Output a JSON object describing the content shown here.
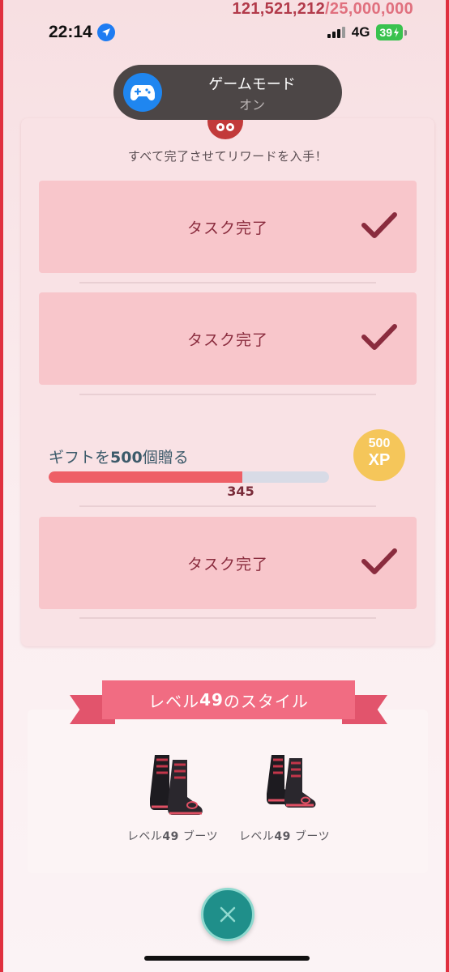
{
  "top_progress": {
    "current": "121,521,212",
    "separator": "/",
    "goal": "25,000,000"
  },
  "status_bar": {
    "time": "22:14",
    "network": "4G",
    "battery": "39"
  },
  "toast": {
    "title": "ゲームモード",
    "subtitle": "オン",
    "icon": "gamepad-icon"
  },
  "research": {
    "subtitle": "すべて完了させてリワードを入手！",
    "tasks": [
      {
        "label": "タスク完了",
        "completed": true
      },
      {
        "label": "タスク完了",
        "completed": true
      },
      {
        "label": "タスク完了",
        "completed": true
      }
    ],
    "gift_task": {
      "label_prefix": "ギフトを",
      "label_number": "500",
      "label_suffix": "個贈る",
      "progress_value": "345",
      "progress_fraction": 0.69,
      "reward_amount": "500",
      "reward_unit": "XP"
    }
  },
  "style_section": {
    "banner_prefix": "レベル",
    "banner_number": "49",
    "banner_suffix": "のスタイル",
    "items": [
      {
        "prefix": "レベル",
        "number": "49",
        "suffix": " ブーツ",
        "icon": "boots-icon"
      },
      {
        "prefix": "レベル",
        "number": "49",
        "suffix": " ブーツ",
        "icon": "boots-icon"
      }
    ]
  },
  "colors": {
    "accent": "#e0303f",
    "task_card": "#f8c6cb",
    "check": "#8a2c3e",
    "progress": "#ee5f66",
    "xp": "#f5c65a",
    "close": "#1f8f8a"
  }
}
